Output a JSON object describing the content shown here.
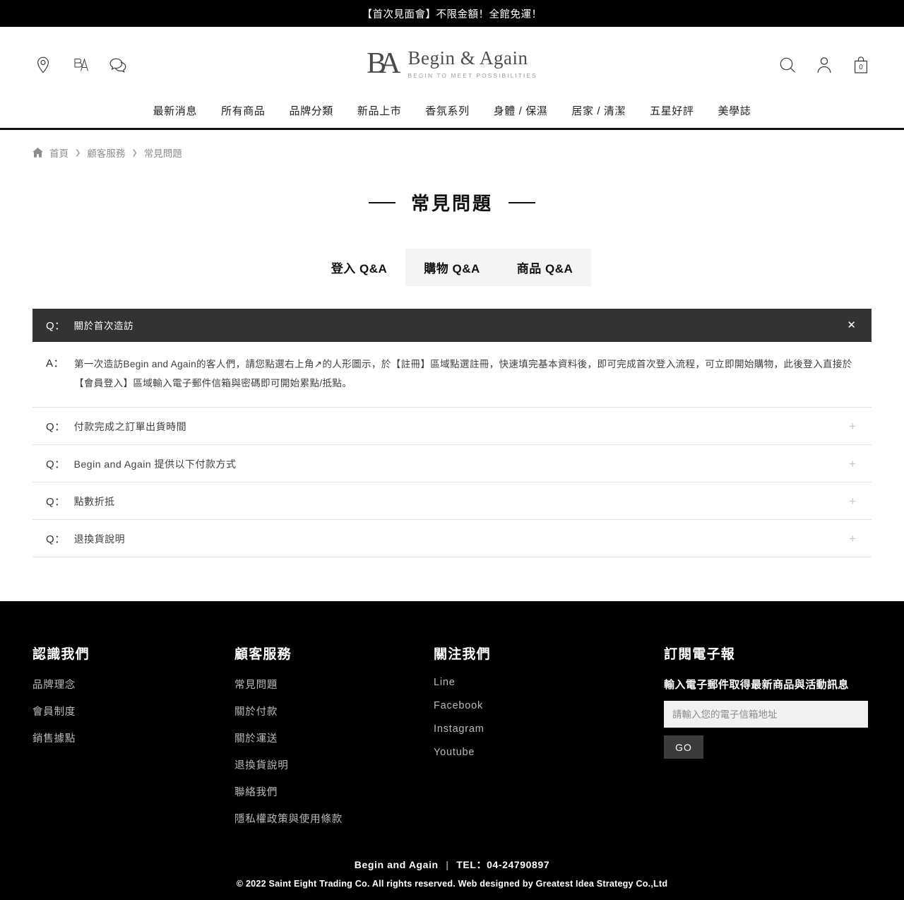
{
  "promo": {
    "text": "【首次見面會】不限金額！全館免運！"
  },
  "header": {
    "icons": {
      "location": "location-pin-icon",
      "monogram": "ba-monogram-icon",
      "chat": "chat-bubbles-icon",
      "search": "search-icon",
      "account": "user-account-icon",
      "cart": "shopping-bag-icon"
    },
    "logo": {
      "mark": "BA",
      "name": "Begin & Again",
      "tagline": "BEGIN TO MEET POSSIBILITIES"
    },
    "cart_count": "0"
  },
  "nav": {
    "items": [
      {
        "label": "最新消息"
      },
      {
        "label": "所有商品"
      },
      {
        "label": "品牌分類"
      },
      {
        "label": "新品上市"
      },
      {
        "label": "香氛系列"
      },
      {
        "label": "身體 / 保濕"
      },
      {
        "label": "居家 / 清潔"
      },
      {
        "label": "五星好評"
      },
      {
        "label": "美學誌"
      }
    ]
  },
  "breadcrumb": {
    "home": "首頁",
    "sep": "❯",
    "level2": "顧客服務",
    "level3": "常見問題"
  },
  "page": {
    "title": "常見問題"
  },
  "tabs": [
    {
      "label": "登入 Q&A",
      "active": false,
      "shaded": false
    },
    {
      "label": "購物 Q&A",
      "active": true,
      "shaded": true
    },
    {
      "label": "商品 Q&A",
      "active": false,
      "shaded": true
    }
  ],
  "faq": {
    "q_prefix": "Q：",
    "a_prefix": "A：",
    "close_icon": "✕",
    "plus_icon": "+",
    "open_item": {
      "question": "關於首次造訪",
      "answer": "第一次造訪Begin and Again的客人們，請您點選右上角↗的人形圖示，於【註冊】區域點選註冊，快速填完基本資料後，即可完成首次登入流程，可立即開始購物，此後登入直接於【會員登入】區域輸入電子郵件信箱與密碼即可開始累點/抵點。"
    },
    "items": [
      {
        "question": "付款完成之訂單出貨時間"
      },
      {
        "question": "Begin and Again 提供以下付款方式"
      },
      {
        "question": "點數折抵"
      },
      {
        "question": "退換貨說明"
      }
    ]
  },
  "footer": {
    "columns": [
      {
        "title": "認識我們",
        "links": [
          "品牌理念",
          "會員制度",
          "銷售據點"
        ]
      },
      {
        "title": "顧客服務",
        "links": [
          "常見問題",
          "關於付款",
          "關於運送",
          "退換貨說明",
          "聯絡我們",
          "隱私權政策與使用條款"
        ]
      },
      {
        "title": "關注我們",
        "links": [
          "Line",
          "Facebook",
          "Instagram",
          "Youtube"
        ]
      }
    ],
    "newsletter": {
      "title": "訂閱電子報",
      "subtitle": "輸入電子郵件取得最新商品與活動訊息",
      "placeholder": "請輸入您的電子信箱地址",
      "button": "GO"
    },
    "bottom": {
      "brand": "Begin and Again",
      "separator": "|",
      "tel": "TEL：04-24790897",
      "copyright": "© 2022 Saint Eight Trading Co. All rights reserved. Web designed by Greatest Idea Strategy Co.,Ltd"
    }
  },
  "colors": {
    "banner_bg": "#000000",
    "nav_underline": "#111111",
    "accordion_open_bg": "#333333",
    "tab_shaded_bg": "#f4f4f4",
    "footer_bg": "#000000",
    "go_button_bg": "#3b3b3b"
  }
}
